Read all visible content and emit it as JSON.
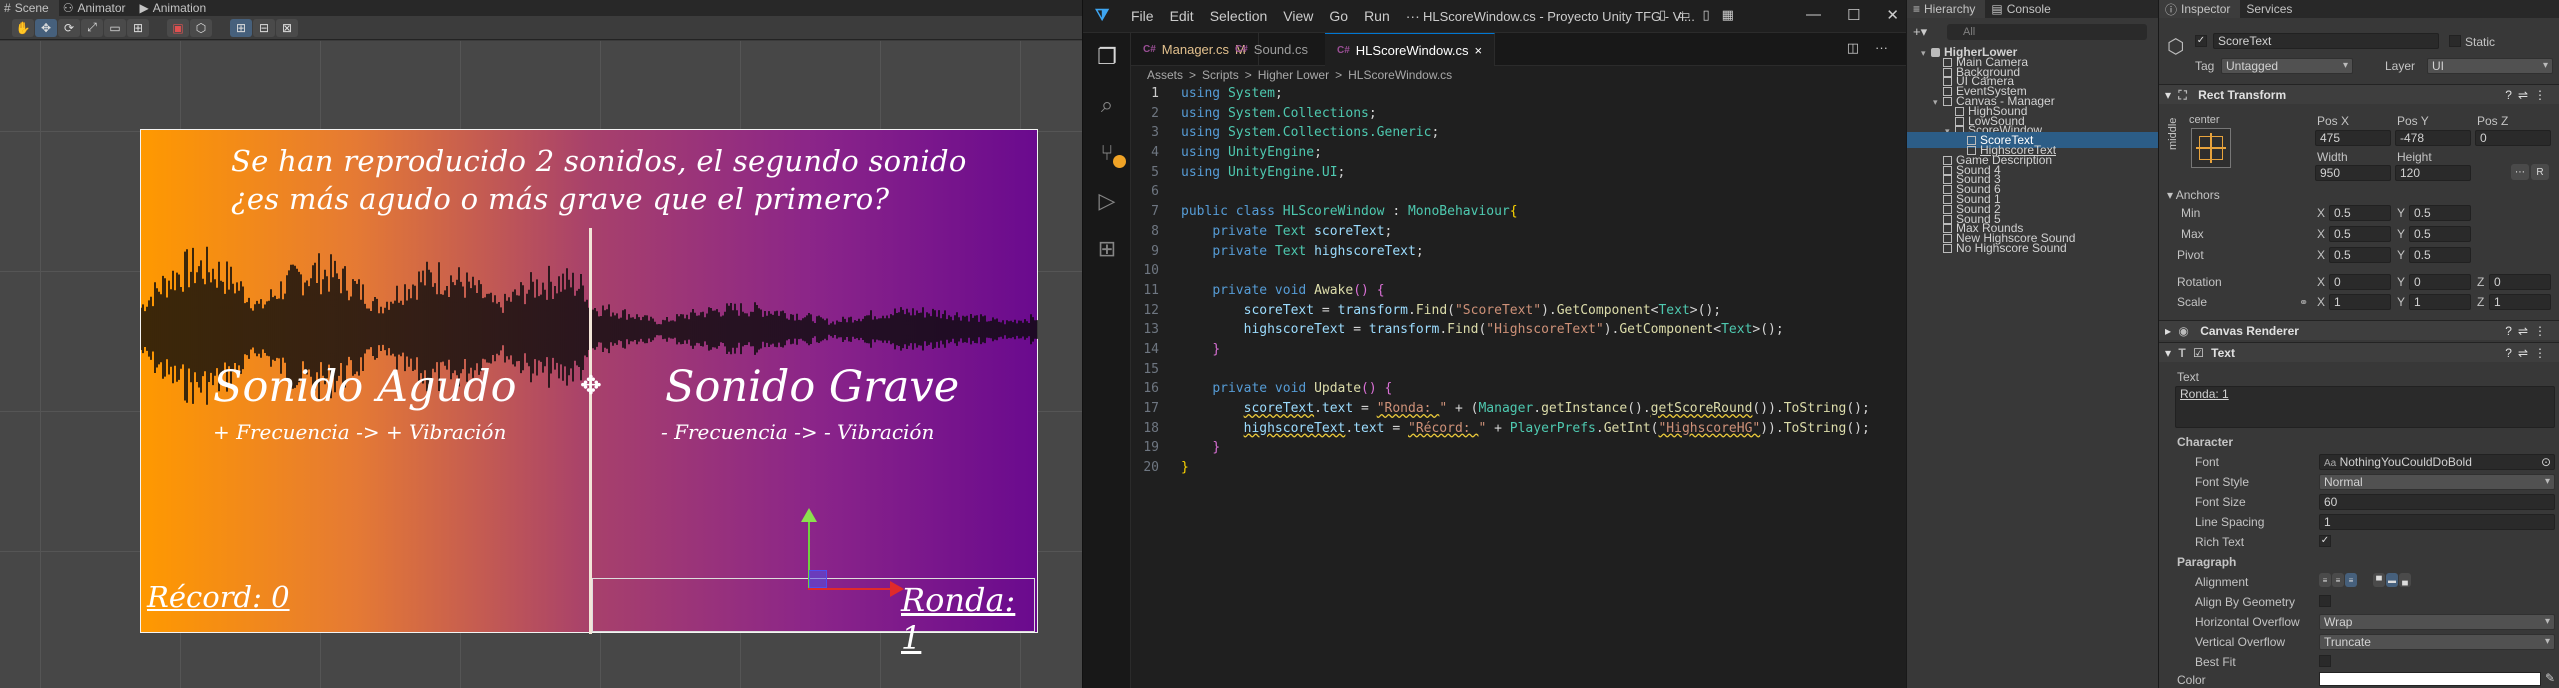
{
  "unity": {
    "scene_tabs": [
      {
        "icon": "#",
        "label": "Scene"
      },
      {
        "icon": "⚇",
        "label": "Animator"
      },
      {
        "icon": "▶",
        "label": "Animation"
      }
    ],
    "canvas": {
      "question_line1": "Se han reproducido 2 sonidos, el segundo sonido",
      "question_line2": "¿es más agudo o más grave que el primero?",
      "high_title": "Sonido Agudo",
      "high_sub": "+ Frecuencia -> + Vibración",
      "low_title": "Sonido Grave",
      "low_sub": "- Frecuencia -> - Vibración",
      "record_text": "Récord: 0",
      "round_text": "Ronda: 1"
    }
  },
  "vscode": {
    "menu": [
      "File",
      "Edit",
      "Selection",
      "View",
      "Go",
      "Run",
      "···"
    ],
    "window_title": "HLScoreWindow.cs - Proyecto Unity TFG - Vi...",
    "tabs": [
      {
        "icon": "C#",
        "label": "Manager.cs",
        "badge": "M"
      },
      {
        "icon": "C#",
        "label": "Sound.cs",
        "badge": ""
      },
      {
        "icon": "C#",
        "label": "HLScoreWindow.cs",
        "badge": "×"
      }
    ],
    "breadcrumb": [
      "Assets",
      ">",
      "Scripts",
      ">",
      "Higher Lower",
      ">",
      "HLScoreWindow.cs"
    ],
    "accent": "#0078d4",
    "code": [
      [
        [
          "kw",
          "using"
        ],
        [
          "pl",
          " "
        ],
        [
          "ty",
          "System"
        ],
        [
          "pl",
          ";"
        ]
      ],
      [
        [
          "kw",
          "using"
        ],
        [
          "pl",
          " "
        ],
        [
          "ty",
          "System.Collections"
        ],
        [
          "pl",
          ";"
        ]
      ],
      [
        [
          "kw",
          "using"
        ],
        [
          "pl",
          " "
        ],
        [
          "ty",
          "System.Collections.Generic"
        ],
        [
          "pl",
          ";"
        ]
      ],
      [
        [
          "kw",
          "using"
        ],
        [
          "pl",
          " "
        ],
        [
          "ty",
          "UnityEngine"
        ],
        [
          "pl",
          ";"
        ]
      ],
      [
        [
          "kw",
          "using"
        ],
        [
          "pl",
          " "
        ],
        [
          "ty",
          "UnityEngine.UI"
        ],
        [
          "pl",
          ";"
        ]
      ],
      [],
      [
        [
          "kw",
          "public class"
        ],
        [
          "pl",
          " "
        ],
        [
          "ty",
          "HLScoreWindow"
        ],
        [
          "pl",
          " : "
        ],
        [
          "ty",
          "MonoBehaviour"
        ],
        [
          "br",
          "{"
        ]
      ],
      [
        [
          "pl",
          "    "
        ],
        [
          "kw",
          "private"
        ],
        [
          "pl",
          " "
        ],
        [
          "ty",
          "Text"
        ],
        [
          "pl",
          " "
        ],
        [
          "va",
          "scoreText"
        ],
        [
          "pl",
          ";"
        ]
      ],
      [
        [
          "pl",
          "    "
        ],
        [
          "kw",
          "private"
        ],
        [
          "pl",
          " "
        ],
        [
          "ty",
          "Text"
        ],
        [
          "pl",
          " "
        ],
        [
          "va",
          "highscoreText"
        ],
        [
          "pl",
          ";"
        ]
      ],
      [],
      [
        [
          "pl",
          "    "
        ],
        [
          "kw",
          "private void"
        ],
        [
          "pl",
          " "
        ],
        [
          "fn",
          "Awake"
        ],
        [
          "br2",
          "()"
        ],
        [
          "pl",
          " "
        ],
        [
          "br2",
          "{"
        ]
      ],
      [
        [
          "pl",
          "        "
        ],
        [
          "va",
          "scoreText"
        ],
        [
          "pl",
          " = "
        ],
        [
          "va",
          "transform"
        ],
        [
          "pl",
          "."
        ],
        [
          "fn",
          "Find"
        ],
        [
          "pl",
          "("
        ],
        [
          "st",
          "\"ScoreText\""
        ],
        [
          "pl",
          ")."
        ],
        [
          "fn",
          "GetComponent"
        ],
        [
          "pl",
          "<"
        ],
        [
          "ty",
          "Text"
        ],
        [
          "pl",
          ">();"
        ]
      ],
      [
        [
          "pl",
          "        "
        ],
        [
          "va",
          "highscoreText"
        ],
        [
          "pl",
          " = "
        ],
        [
          "va",
          "transform"
        ],
        [
          "pl",
          "."
        ],
        [
          "fn",
          "Find"
        ],
        [
          "pl",
          "("
        ],
        [
          "st",
          "\"HighscoreText\""
        ],
        [
          "pl",
          ")."
        ],
        [
          "fn",
          "GetComponent"
        ],
        [
          "pl",
          "<"
        ],
        [
          "ty",
          "Text"
        ],
        [
          "pl",
          ">();"
        ]
      ],
      [
        [
          "pl",
          "    "
        ],
        [
          "br2",
          "}"
        ]
      ],
      [],
      [
        [
          "pl",
          "    "
        ],
        [
          "kw",
          "private void"
        ],
        [
          "pl",
          " "
        ],
        [
          "fn",
          "Update"
        ],
        [
          "br2",
          "()"
        ],
        [
          "pl",
          " "
        ],
        [
          "br2",
          "{"
        ]
      ],
      [
        [
          "pl",
          "        "
        ],
        [
          "va",
          "scoreText",
          "sq"
        ],
        [
          "pl",
          "."
        ],
        [
          "va",
          "text"
        ],
        [
          "pl",
          " = "
        ],
        [
          "st",
          "\"Ronda: ",
          "sq"
        ],
        [
          "st",
          "\""
        ],
        [
          "pl",
          " + ("
        ],
        [
          "ty",
          "Manager"
        ],
        [
          "pl",
          "."
        ],
        [
          "fn",
          "getInstance"
        ],
        [
          "pl",
          "()."
        ],
        [
          "fn",
          "getScoreRound",
          "sq"
        ],
        [
          "pl",
          "())."
        ],
        [
          "fn",
          "ToString"
        ],
        [
          "pl",
          "();"
        ]
      ],
      [
        [
          "pl",
          "        "
        ],
        [
          "va",
          "highscoreText",
          "sq"
        ],
        [
          "pl",
          "."
        ],
        [
          "va",
          "text"
        ],
        [
          "pl",
          " = "
        ],
        [
          "st",
          "\"Récord: ",
          "sq"
        ],
        [
          "st",
          "\""
        ],
        [
          "pl",
          " + "
        ],
        [
          "ty",
          "PlayerPrefs"
        ],
        [
          "pl",
          "."
        ],
        [
          "fn",
          "GetInt"
        ],
        [
          "pl",
          "("
        ],
        [
          "st",
          "\"HighscoreHG\"",
          "sq"
        ],
        [
          "pl",
          "))."
        ],
        [
          "fn",
          "ToString"
        ],
        [
          "pl",
          "();"
        ]
      ],
      [
        [
          "pl",
          "    "
        ],
        [
          "br2",
          "}"
        ]
      ],
      [
        [
          "br",
          "}"
        ]
      ]
    ]
  },
  "hierarchy": {
    "tabs": [
      {
        "icon": "≡",
        "label": "Hierarchy"
      },
      {
        "icon": "▤",
        "label": "Console"
      }
    ],
    "search_placeholder": "All",
    "items": [
      {
        "label": "HigherLower",
        "depth": 0,
        "arrow": "▾",
        "root": true
      },
      {
        "label": "Main Camera",
        "depth": 1,
        "arrow": ""
      },
      {
        "label": "Background",
        "depth": 1,
        "arrow": ""
      },
      {
        "label": "UI Camera",
        "depth": 1,
        "arrow": ""
      },
      {
        "label": "EventSystem",
        "depth": 1,
        "arrow": ""
      },
      {
        "label": "Canvas - Manager",
        "depth": 1,
        "arrow": "▾"
      },
      {
        "label": "HighSound",
        "depth": 2,
        "arrow": ""
      },
      {
        "label": "LowSound",
        "depth": 2,
        "arrow": ""
      },
      {
        "label": "ScoreWindow",
        "depth": 2,
        "arrow": "▾"
      },
      {
        "label": "ScoreText",
        "depth": 3,
        "arrow": "",
        "selected": true
      },
      {
        "label": "HighscoreText",
        "depth": 3,
        "arrow": ""
      },
      {
        "label": "Game Description",
        "depth": 1,
        "arrow": ""
      },
      {
        "label": "Sound 4",
        "depth": 1,
        "arrow": ""
      },
      {
        "label": "Sound 3",
        "depth": 1,
        "arrow": ""
      },
      {
        "label": "Sound 6",
        "depth": 1,
        "arrow": ""
      },
      {
        "label": "Sound 1",
        "depth": 1,
        "arrow": ""
      },
      {
        "label": "Sound 2",
        "depth": 1,
        "arrow": ""
      },
      {
        "label": "Sound 5",
        "depth": 1,
        "arrow": ""
      },
      {
        "label": "Max Rounds",
        "depth": 1,
        "arrow": ""
      },
      {
        "label": "New Highscore Sound",
        "depth": 1,
        "arrow": ""
      },
      {
        "label": "No Highscore Sound",
        "depth": 1,
        "arrow": ""
      }
    ]
  },
  "inspector": {
    "tabs": [
      {
        "icon": "ⓘ",
        "label": "Inspector"
      },
      {
        "icon": "",
        "label": "Services"
      }
    ],
    "object_name": "ScoreText",
    "static_label": "Static",
    "tag_label": "Tag",
    "tag_value": "Untagged",
    "layer_label": "Layer",
    "layer_value": "UI",
    "rect_transform": {
      "title": "Rect Transform",
      "anchor_h": "center",
      "anchor_v": "middle",
      "posx_label": "Pos X",
      "posy_label": "Pos Y",
      "posz_label": "Pos Z",
      "posx": "475",
      "posy": "-478",
      "posz": "0",
      "width_label": "Width",
      "height_label": "Height",
      "width": "950",
      "height": "120",
      "anchors_label": "Anchors",
      "min_label": "Min",
      "max_label": "Max",
      "pivot_label": "Pivot",
      "x_label": "X",
      "y_label": "Y",
      "z_label": "Z",
      "min_x": "0.5",
      "min_y": "0.5",
      "max_x": "0.5",
      "max_y": "0.5",
      "pivot_x": "0.5",
      "pivot_y": "0.5",
      "rotation_label": "Rotation",
      "rot_x": "0",
      "rot_y": "0",
      "rot_z": "0",
      "scale_label": "Scale",
      "scale_x": "1",
      "scale_y": "1",
      "scale_z": "1"
    },
    "canvas_renderer": "Canvas Renderer",
    "text_component": {
      "title": "Text",
      "text_label": "Text",
      "text_value": "Ronda: 1",
      "character_label": "Character",
      "font_label": "Font",
      "font_value": "NothingYouCouldDoBold",
      "font_style_label": "Font Style",
      "font_style_value": "Normal",
      "font_size_label": "Font Size",
      "font_size_value": "60",
      "line_spacing_label": "Line Spacing",
      "line_spacing_value": "1",
      "rich_text_label": "Rich Text",
      "paragraph_label": "Paragraph",
      "alignment_label": "Alignment",
      "align_geometry_label": "Align By Geometry",
      "h_overflow_label": "Horizontal Overflow",
      "h_overflow_value": "Wrap",
      "v_overflow_label": "Vertical Overflow",
      "v_overflow_value": "Truncate",
      "best_fit_label": "Best Fit",
      "color_label": "Color"
    }
  }
}
